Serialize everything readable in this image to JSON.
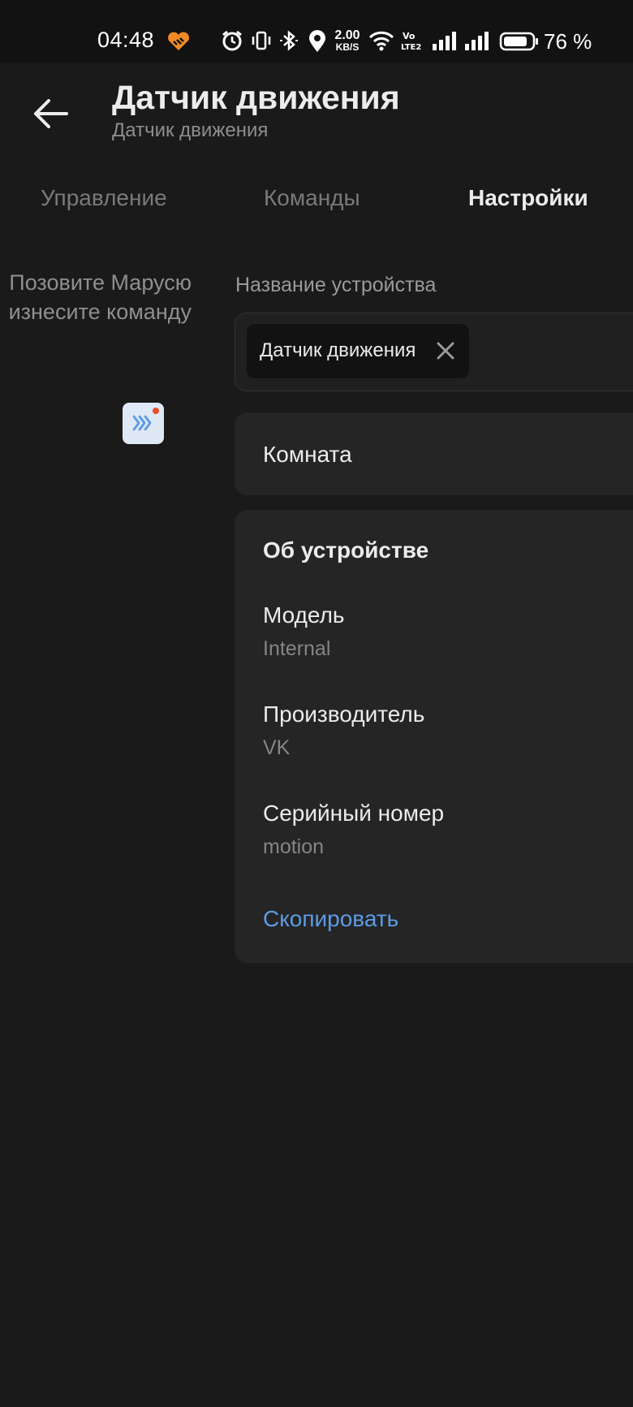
{
  "status_bar": {
    "time": "04:48",
    "speed_value": "2.00",
    "speed_unit": "KB/S",
    "battery_percent": "76 %",
    "icons": [
      "heart-app-icon",
      "alarm-icon",
      "vibrate-icon",
      "bluetooth-icon",
      "location-icon",
      "wifi-icon",
      "volte-icon",
      "signal-icon",
      "signal-icon",
      "battery-icon"
    ]
  },
  "header": {
    "title": "Датчик движения",
    "subtitle": "Датчик движения"
  },
  "tabs": [
    {
      "label": "Управление",
      "active": false
    },
    {
      "label": "Команды",
      "active": false
    },
    {
      "label": "Настройки",
      "active": true
    }
  ],
  "left_panel": {
    "hint_line1": "Позовите Марусю",
    "hint_line2": "изнесите команду",
    "icon": "voice-wave-icon"
  },
  "settings": {
    "name_label": "Название устройства",
    "name_value": "Датчик движения",
    "room_label": "Комната",
    "about_title": "Об устройстве",
    "model_label": "Модель",
    "model_value": "Internal",
    "manufacturer_label": "Производитель",
    "manufacturer_value": "VK",
    "serial_label": "Серийный номер",
    "serial_value": "motion",
    "copy_label": "Скопировать"
  },
  "colors": {
    "background": "#1a1a1a",
    "card": "#252525",
    "accent_link": "#5b9be6",
    "accent_red": "#e54d3f",
    "orange_app": "#f08a24"
  }
}
